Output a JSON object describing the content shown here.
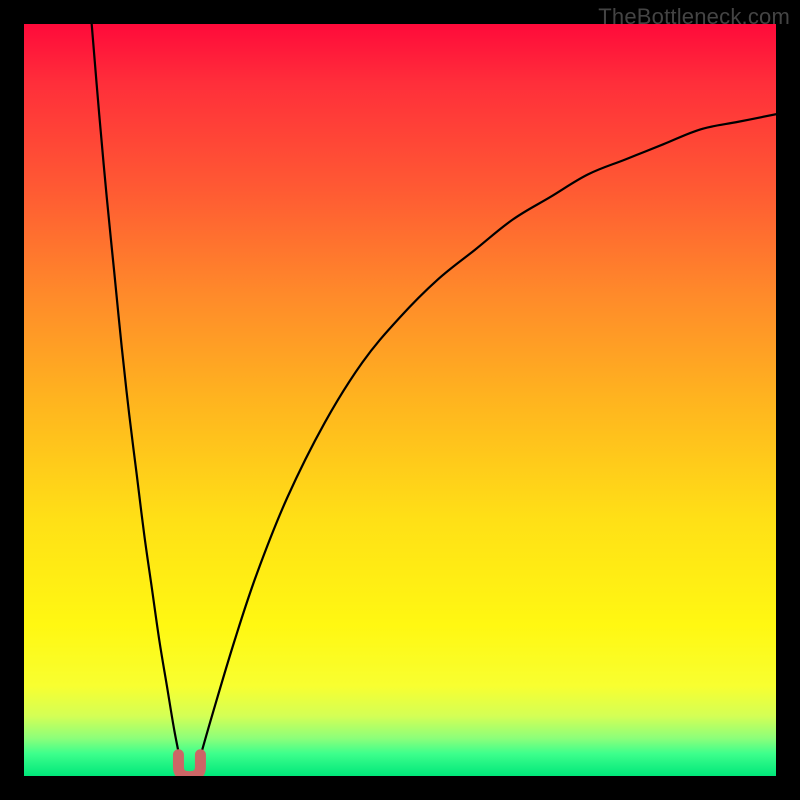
{
  "watermark": "TheBottleneck.com",
  "colors": {
    "frame": "#000000",
    "curve": "#000000",
    "marker_fill": "#cc6666",
    "gradient_stops": [
      "#ff0a3a",
      "#ff2f3a",
      "#ff5a33",
      "#ff8a2a",
      "#ffb41f",
      "#ffe016",
      "#fff812",
      "#f8ff30",
      "#d4ff55",
      "#8cff7a",
      "#3eff8c",
      "#00e77a"
    ]
  },
  "chart_data": {
    "type": "line",
    "title": "",
    "xlabel": "",
    "ylabel": "",
    "xlim": [
      0,
      100
    ],
    "ylim": [
      0,
      100
    ],
    "annotations": [],
    "series": [
      {
        "name": "left-branch",
        "x": [
          9,
          10,
          11,
          12,
          13,
          14,
          15,
          16,
          17,
          18,
          19,
          20,
          21
        ],
        "y": [
          100,
          88,
          77,
          67,
          57,
          48,
          40,
          32,
          25,
          18,
          12,
          6,
          1
        ]
      },
      {
        "name": "right-branch",
        "x": [
          23,
          25,
          28,
          31,
          35,
          40,
          45,
          50,
          55,
          60,
          65,
          70,
          75,
          80,
          85,
          90,
          95,
          100
        ],
        "y": [
          1,
          8,
          18,
          27,
          37,
          47,
          55,
          61,
          66,
          70,
          74,
          77,
          80,
          82,
          84,
          86,
          87,
          88
        ]
      }
    ],
    "optimum_marker": {
      "x": 22,
      "y": 0.7,
      "shape": "u"
    }
  }
}
